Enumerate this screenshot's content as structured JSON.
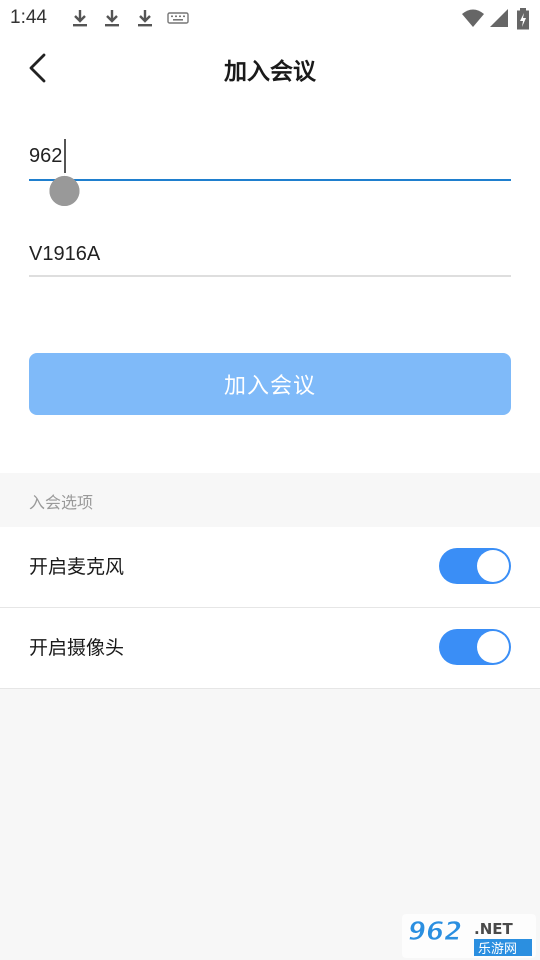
{
  "status_bar": {
    "time": "1:44",
    "left_icons": [
      "download-icon",
      "download-icon",
      "download-icon",
      "keyboard-icon"
    ],
    "right_icons": [
      "wifi-icon",
      "signal-icon",
      "battery-charging-icon"
    ]
  },
  "header": {
    "title": "加入会议",
    "back_icon": "chevron-left-icon"
  },
  "form": {
    "meeting_id_value": "962",
    "name_value": "V1916A"
  },
  "join_button": {
    "label": "加入会议"
  },
  "options": {
    "section_label": "入会选项",
    "items": [
      {
        "label": "开启麦克风",
        "enabled": true
      },
      {
        "label": "开启摄像头",
        "enabled": true
      }
    ]
  },
  "watermark": {
    "brand": "962.NET",
    "sub": "乐游网"
  },
  "colors": {
    "accent": "#1f7fce",
    "button_disabled": "#7fbaf9",
    "toggle_on": "#3a8ef6",
    "background": "#f7f7f7"
  }
}
